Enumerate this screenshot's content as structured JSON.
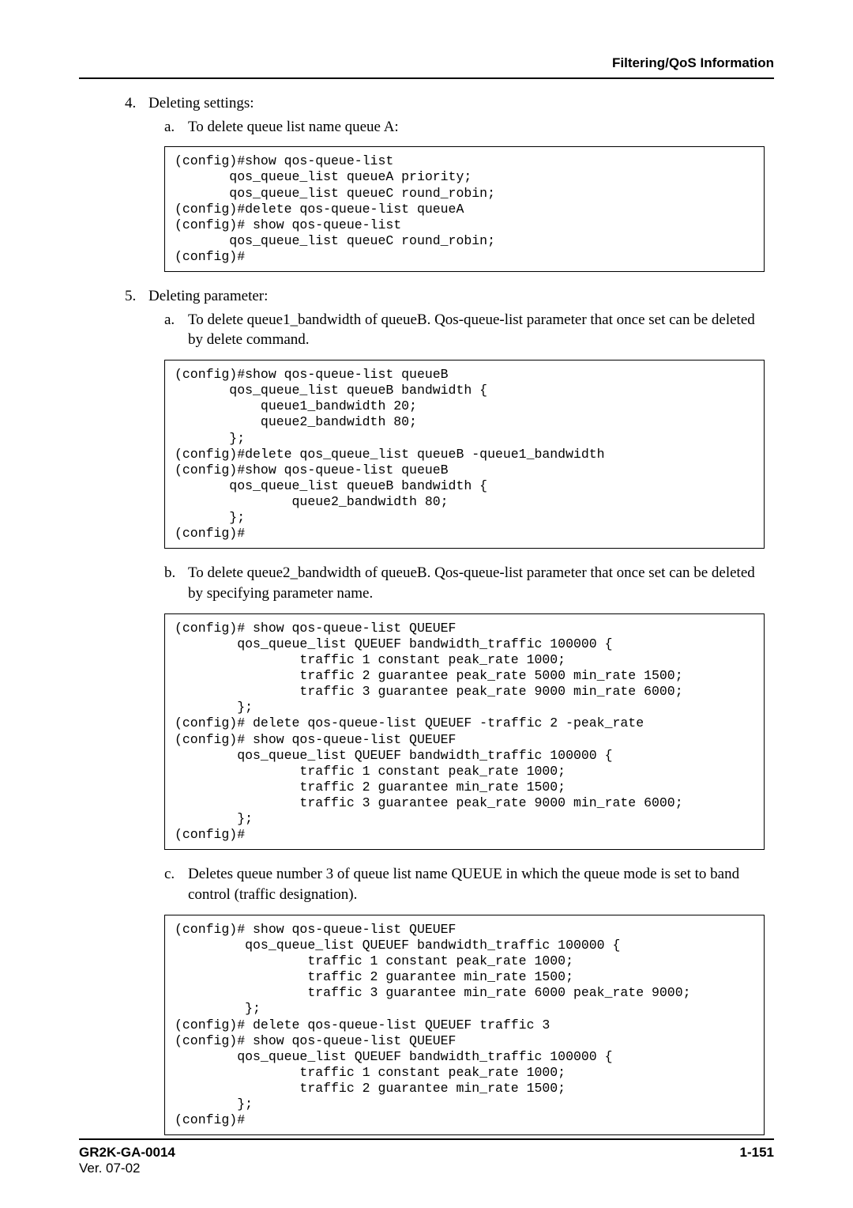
{
  "header": {
    "title": "Filtering/QoS Information"
  },
  "items": {
    "n4": {
      "num": "4.",
      "title": "Deleting settings:",
      "sub_a": {
        "num": "a.",
        "text": "To delete queue list name queue A:"
      },
      "code_a": "(config)#show qos-queue-list\n       qos_queue_list queueA priority;\n       qos_queue_list queueC round_robin;\n(config)#delete qos-queue-list queueA\n(config)# show qos-queue-list\n       qos_queue_list queueC round_robin;\n(config)#"
    },
    "n5": {
      "num": "5.",
      "title": "Deleting parameter:",
      "sub_a": {
        "num": "a.",
        "text": "To delete queue1_bandwidth of queueB. Qos-queue-list parameter that once set can be deleted by delete command."
      },
      "code_a": "(config)#show qos-queue-list queueB\n       qos_queue_list queueB bandwidth {\n           queue1_bandwidth 20;\n           queue2_bandwidth 80;\n       };\n(config)#delete qos_queue_list queueB -queue1_bandwidth\n(config)#show qos-queue-list queueB\n       qos_queue_list queueB bandwidth {\n               queue2_bandwidth 80;\n       };\n(config)#",
      "sub_b": {
        "num": "b.",
        "text": "To delete queue2_bandwidth of queueB. Qos-queue-list parameter that once set can be deleted by specifying parameter name."
      },
      "code_b": "(config)# show qos-queue-list QUEUEF\n        qos_queue_list QUEUEF bandwidth_traffic 100000 {\n                traffic 1 constant peak_rate 1000;\n                traffic 2 guarantee peak_rate 5000 min_rate 1500;\n                traffic 3 guarantee peak_rate 9000 min_rate 6000;\n        };\n(config)# delete qos-queue-list QUEUEF -traffic 2 -peak_rate\n(config)# show qos-queue-list QUEUEF\n        qos_queue_list QUEUEF bandwidth_traffic 100000 {\n                traffic 1 constant peak_rate 1000;\n                traffic 2 guarantee min_rate 1500;\n                traffic 3 guarantee peak_rate 9000 min_rate 6000;\n        };\n(config)#",
      "sub_c": {
        "num": "c.",
        "text": "Deletes queue number 3 of queue list name QUEUE in which the queue mode is set to band control (traffic designation)."
      },
      "code_c": "(config)# show qos-queue-list QUEUEF\n         qos_queue_list QUEUEF bandwidth_traffic 100000 {\n                 traffic 1 constant peak_rate 1000;\n                 traffic 2 guarantee min_rate 1500;\n                 traffic 3 guarantee min_rate 6000 peak_rate 9000;\n         };\n(config)# delete qos-queue-list QUEUEF traffic 3\n(config)# show qos-queue-list QUEUEF\n        qos_queue_list QUEUEF bandwidth_traffic 100000 {\n                traffic 1 constant peak_rate 1000;\n                traffic 2 guarantee min_rate 1500;\n        };\n(config)#"
    }
  },
  "footer": {
    "doc_id": "GR2K-GA-0014",
    "version": "Ver. 07-02",
    "page": "1-151"
  }
}
